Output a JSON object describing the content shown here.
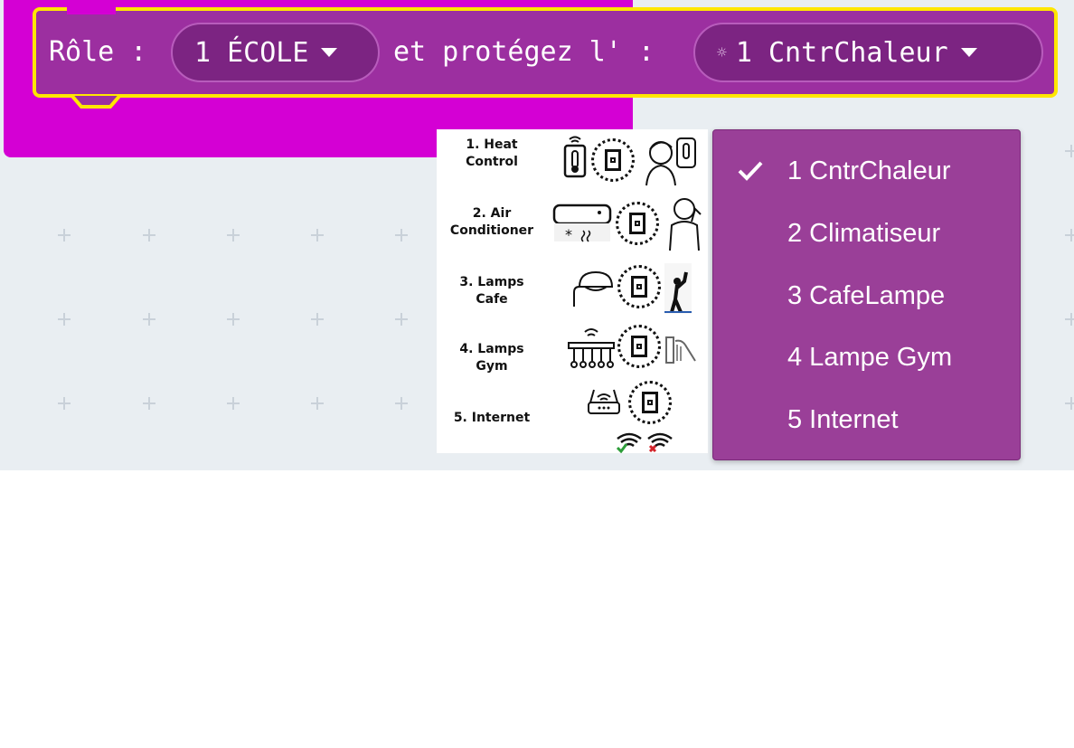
{
  "block": {
    "role_label": "Rôle :",
    "role_value": "1 ÉCOLE",
    "protect_label": "et protégez l' :",
    "protect_icon": "sun-small-icon",
    "protect_value": "1 CntrChaleur"
  },
  "legend": {
    "items": [
      {
        "line1": "1. Heat",
        "line2": "Control",
        "icons": [
          "thermostat-phone-icon",
          "chip-icon",
          "person-thermometer-icon"
        ]
      },
      {
        "line1": "2. Air",
        "line2": "Conditioner",
        "icons": [
          "air-conditioner-icon",
          "chip-icon",
          "person-hot-icon"
        ]
      },
      {
        "line1": "3. Lamps",
        "line2": "Cafe",
        "icons": [
          "wall-lamp-icon",
          "chip-icon",
          "person-switch-icon"
        ]
      },
      {
        "line1": "4. Lamps",
        "line2": "Gym",
        "icons": [
          "ceiling-lamp-icon",
          "chip-icon",
          "hand-switch-icon"
        ]
      },
      {
        "line1": "5. Internet",
        "line2": "",
        "icons": [
          "router-icon",
          "chip-icon",
          "wifi-ok-icon",
          "wifi-off-icon"
        ]
      }
    ]
  },
  "dropdown": {
    "selected_index": 0,
    "options": [
      "1 CntrChaleur",
      "2 Climatiseur",
      "3 CafeLampe",
      "4 Lampe Gym",
      "5 Internet"
    ],
    "check_icon": "checkmark-icon"
  },
  "colors": {
    "workspace_bg": "#e9eef2",
    "outer_block": "#d400d4",
    "role_block": "#9c2fa0",
    "highlight": "#ffe600",
    "dropdown_bg": "#9a3f98"
  }
}
